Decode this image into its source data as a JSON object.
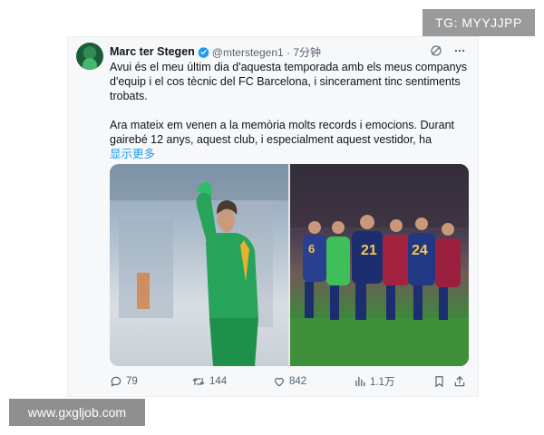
{
  "watermarks": {
    "top": "TG: MYYJJPP",
    "bottom": "www.gxgljob.com"
  },
  "tweet": {
    "display_name": "Marc ter Stegen",
    "handle_time": "@mterstegen1 · 7分钟",
    "paragraph_1": "Avui és el meu últim dia d'aquesta temporada amb els meus companys d'equip i el cos tècnic del FC Barcelona, i sincerament tinc sentiments trobats.",
    "paragraph_2": "Ara mateix em venen a la memòria molts records i emocions. Durant gairebé 12 anys, aquest club, i especialment aquest vestidor, ha",
    "show_more": "显示更多"
  },
  "actions": {
    "replies": "79",
    "retweets": "144",
    "likes": "842",
    "views": "1.1万"
  },
  "colors": {
    "accent": "#1d9bf0",
    "muted": "#536471",
    "text": "#0f1419",
    "card_bg": "#f7f8f9"
  },
  "icons": [
    "verified-badge-icon",
    "grok-icon",
    "more-icon",
    "reply-icon",
    "retweet-icon",
    "like-icon",
    "views-icon",
    "bookmark-icon",
    "share-icon"
  ]
}
